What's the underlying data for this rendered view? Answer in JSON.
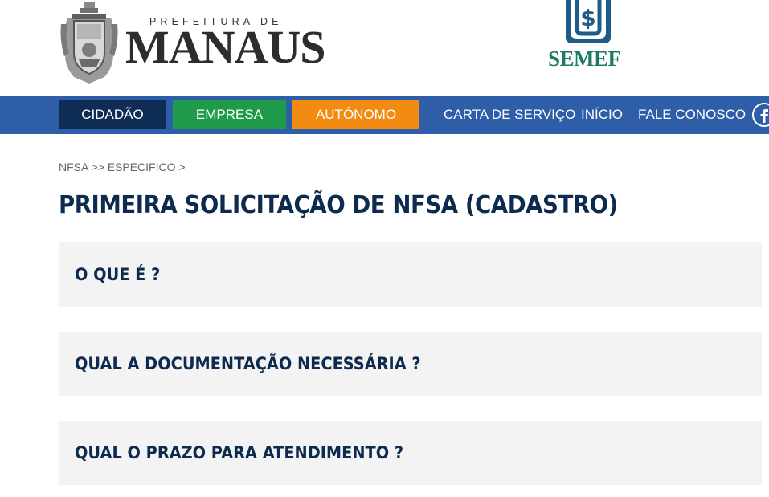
{
  "header": {
    "prefeitura_small": "PREFEITURA DE",
    "prefeitura_big": "MANAUS",
    "semef": "SEMEF"
  },
  "nav": {
    "cidadao": "CIDADÃO",
    "empresa": "EMPRESA",
    "autonomo": "AUTÔNOMO",
    "carta": "CARTA DE SERVIÇO",
    "inicio": "INÍCIO",
    "fale": "FALE CONOSCO"
  },
  "breadcrumb": "NFSA >> ESPECIFICO >",
  "page_title": "PRIMEIRA SOLICITAÇÃO DE NFSA (CADASTRO)",
  "accordion": [
    {
      "label": "O QUE É ?"
    },
    {
      "label": "QUAL A DOCUMENTAÇÃO NECESSÁRIA ?"
    },
    {
      "label": "QUAL O PRAZO PARA ATENDIMENTO ?"
    }
  ],
  "colors": {
    "nav_bg": "#2e5ea8",
    "cidadao": "#0f2c55",
    "empresa": "#1f9a4a",
    "autonomo": "#f38b12",
    "title": "#0d2a4f",
    "semef_green": "#1c7a62",
    "semef_blue": "#1e5d87"
  },
  "icons": {
    "crest": "city-crest-icon",
    "semef": "dollar-document-icon",
    "facebook": "facebook-icon"
  }
}
